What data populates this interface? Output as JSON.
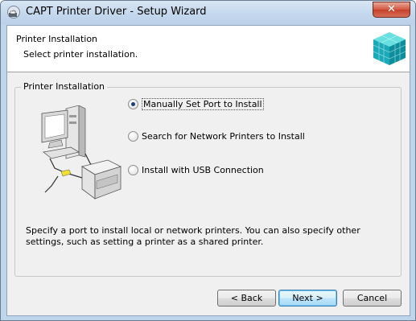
{
  "window": {
    "title": "CAPT Printer Driver - Setup Wizard",
    "close_label": "✕",
    "icons": {
      "app": "printer-cd-icon",
      "close": "close-icon"
    }
  },
  "header": {
    "title": "Printer Installation",
    "subtitle": "Select printer installation.",
    "logo_icon": "canon-cube-logo"
  },
  "group": {
    "title": "Printer Installation",
    "illustration_icon": "computer-printer-illustration",
    "options": [
      {
        "label": "Manually Set Port to Install",
        "checked": true
      },
      {
        "label": "Search for Network Printers to Install",
        "checked": false
      },
      {
        "label": "Install with USB Connection",
        "checked": false
      }
    ],
    "description": "Specify a port to install local or network printers. You can also specify other settings, such as setting a printer as a shared printer."
  },
  "buttons": {
    "back": "< Back",
    "next": "Next >",
    "cancel": "Cancel"
  },
  "colors": {
    "titlebar": "#c2d6ec",
    "client_bg": "#f0f0f0",
    "close_button": "#c4402a"
  }
}
